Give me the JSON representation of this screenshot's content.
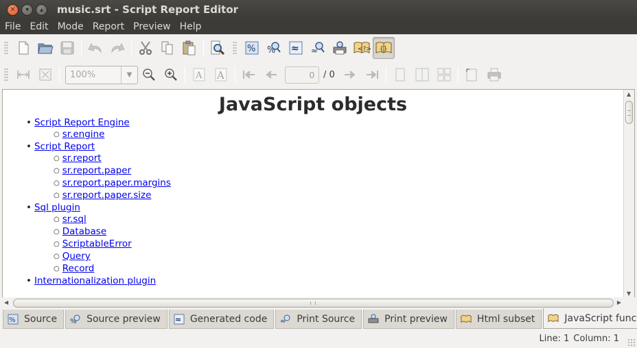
{
  "window": {
    "title": "music.srt - Script Report Editor",
    "close_icon": "close-icon",
    "minimize_icon": "minimize-icon",
    "maximize_icon": "maximize-icon"
  },
  "menu": [
    "File",
    "Edit",
    "Mode",
    "Report",
    "Preview",
    "Help"
  ],
  "toolbar_main": {
    "buttons": [
      "new-file-icon",
      "open-folder-icon",
      "save-icon",
      "undo-icon",
      "redo-icon",
      "cut-icon",
      "copy-icon",
      "paste-icon",
      "find-icon",
      "source-mode-icon",
      "source-preview-icon",
      "generated-code-icon",
      "print-source-icon",
      "print-preview-icon",
      "html-subset-icon",
      "javascript-functions-icon"
    ],
    "active": "javascript-functions-icon"
  },
  "toolbar_preview": {
    "zoom_value": "100%",
    "page_value": "0",
    "page_total": "/ 0"
  },
  "document": {
    "heading": "JavaScript objects",
    "sections": [
      {
        "label": "Script Report Engine",
        "items": [
          "sr.engine"
        ]
      },
      {
        "label": "Script Report",
        "items": [
          "sr.report",
          "sr.report.paper",
          "sr.report.paper.margins",
          "sr.report.paper.size"
        ]
      },
      {
        "label": "Sql plugin",
        "items": [
          "sr.sql",
          "Database",
          "ScriptableError",
          "Query",
          "Record"
        ]
      },
      {
        "label": "Internationalization plugin",
        "items": []
      }
    ]
  },
  "tabs": [
    {
      "label": "Source",
      "icon": "source-mode-icon"
    },
    {
      "label": "Source preview",
      "icon": "source-preview-icon"
    },
    {
      "label": "Generated code",
      "icon": "generated-code-icon"
    },
    {
      "label": "Print Source",
      "icon": "print-source-icon"
    },
    {
      "label": "Print preview",
      "icon": "print-preview-icon"
    },
    {
      "label": "Html subset",
      "icon": "html-subset-icon"
    },
    {
      "label": "JavaScript functions",
      "icon": "javascript-functions-icon"
    }
  ],
  "selected_tab": "JavaScript functions",
  "status": {
    "line": "Line: 1",
    "column": "Column: 1"
  },
  "colors": {
    "titlebar": "#3c3b37",
    "link": "#0000ee",
    "close_button": "#e0561f",
    "window_bg": "#f2f1f0"
  }
}
